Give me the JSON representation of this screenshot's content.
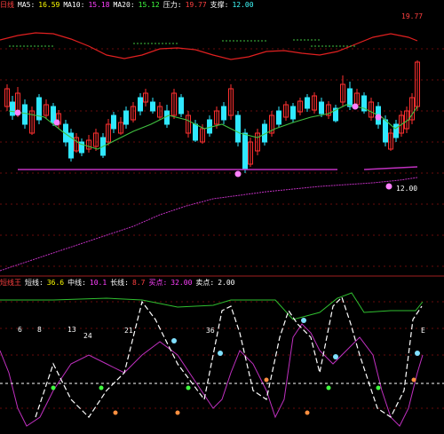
{
  "main_panel": {
    "header": [
      {
        "text": "日线",
        "color": "#ff4040"
      },
      {
        "text": "MA5:",
        "color": "#ffffff"
      },
      {
        "text": "16.59",
        "color": "#ffff00"
      },
      {
        "text": "MA10:",
        "color": "#ffffff"
      },
      {
        "text": "15.18",
        "color": "#ff40ff"
      },
      {
        "text": "MA20:",
        "color": "#ffffff"
      },
      {
        "text": "15.12",
        "color": "#40ff40"
      },
      {
        "text": "压力:",
        "color": "#ffffff"
      },
      {
        "text": "19.77",
        "color": "#ff4040"
      },
      {
        "text": "支撑:",
        "color": "#ffffff"
      },
      {
        "text": "12.00",
        "color": "#40ffff"
      }
    ],
    "right_label": "19.77",
    "low_label": "12.00"
  },
  "indicator_panel": {
    "header": [
      {
        "text": "短线王",
        "color": "#ff4040"
      },
      {
        "text": "短线:",
        "color": "#ffffff"
      },
      {
        "text": "36.6",
        "color": "#ffff00"
      },
      {
        "text": "中线:",
        "color": "#ffffff"
      },
      {
        "text": "10.1",
        "color": "#ff40ff"
      },
      {
        "text": "长线:",
        "color": "#ffffff"
      },
      {
        "text": "8.7",
        "color": "#ff4040"
      },
      {
        "text": "买点:",
        "color": "#ff40ff"
      },
      {
        "text": "32.00",
        "color": "#ff40ff"
      },
      {
        "text": "卖点:",
        "color": "#ffffff"
      },
      {
        "text": "2.00",
        "color": "#ffffff"
      }
    ],
    "value_labels": [
      "6",
      "8",
      "13",
      "24",
      "21",
      "36",
      "E"
    ]
  },
  "colors": {
    "up": "#ff3030",
    "down": "#30e8ff",
    "ma_line": "#40c040",
    "upper_band": "#e02020",
    "support_line": "#c030c0",
    "grid": "#8a1010",
    "short_line": "#ffffff",
    "mid_line": "#c030c0",
    "top_line": "#30c030"
  }
}
